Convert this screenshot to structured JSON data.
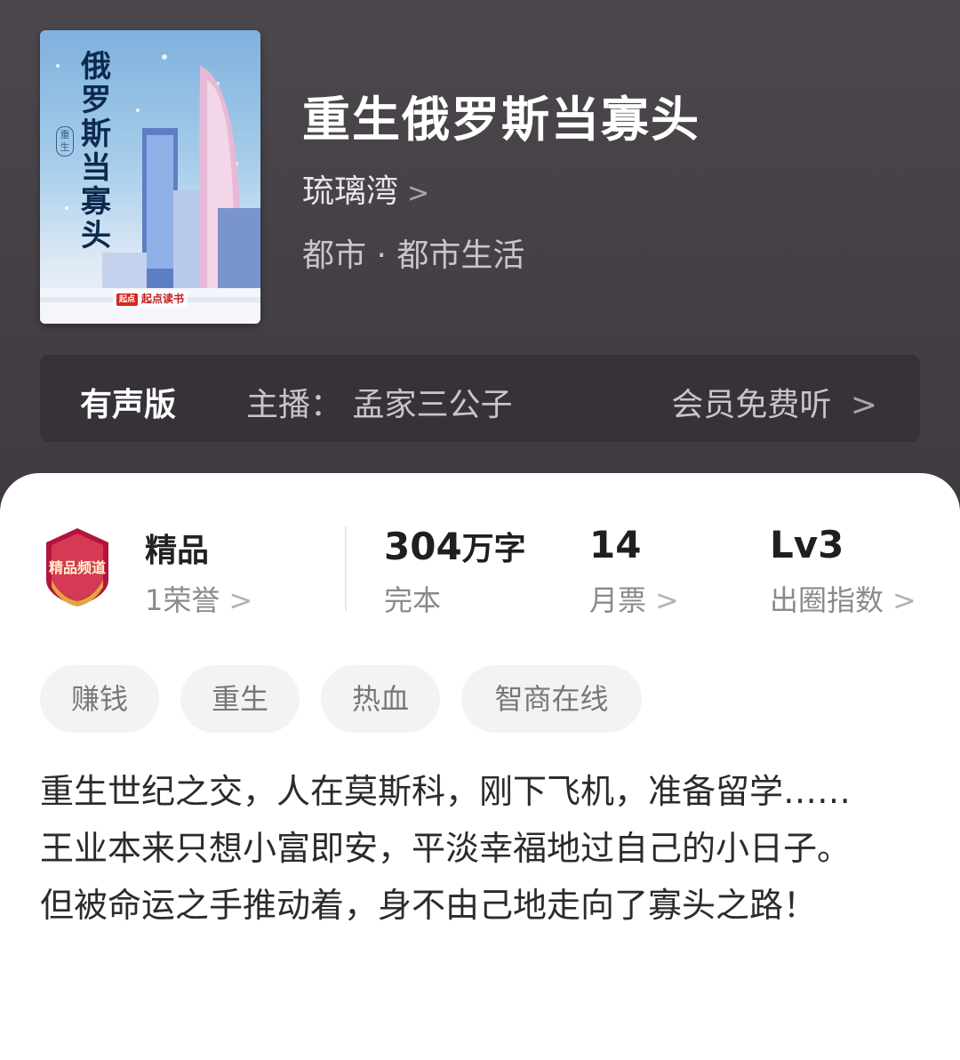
{
  "book": {
    "title": "重生俄罗斯当寡头",
    "author": "琉璃湾",
    "author_chevron": ">",
    "genre": "都市 · 都市生活"
  },
  "cover": {
    "title_vertical": "俄罗斯当寡头",
    "seal_text": "重生",
    "brand_icon": "起点",
    "brand": "起点读书"
  },
  "audio": {
    "label": "有声版",
    "host": "主播：  孟家三公子",
    "action": "会员免费听",
    "chevron": ">"
  },
  "stats": {
    "quality_badge_text": "精品频道",
    "quality": "精品",
    "honor": "1荣誉",
    "word_count": "304",
    "word_unit": "万字",
    "status": "完本",
    "monthly_tickets": "14",
    "monthly_tickets_label": "月票",
    "level": "Lv3",
    "level_label": "出圈指数",
    "chevron": ">"
  },
  "tags": [
    "赚钱",
    "重生",
    "热血",
    "智商在线"
  ],
  "description": [
    "重生世纪之交，人在莫斯科，刚下飞机，准备留学……",
    "王业本来只想小富即安，平淡幸福地过自己的小日子。",
    "但被命运之手推动着，身不由己地走向了寡头之路！"
  ],
  "colors": {
    "header_bg": "#433f44",
    "audio_bg": "#363238",
    "card_bg": "#ffffff",
    "tag_bg": "#f3f3f3",
    "badge_red": "#b3143a"
  }
}
